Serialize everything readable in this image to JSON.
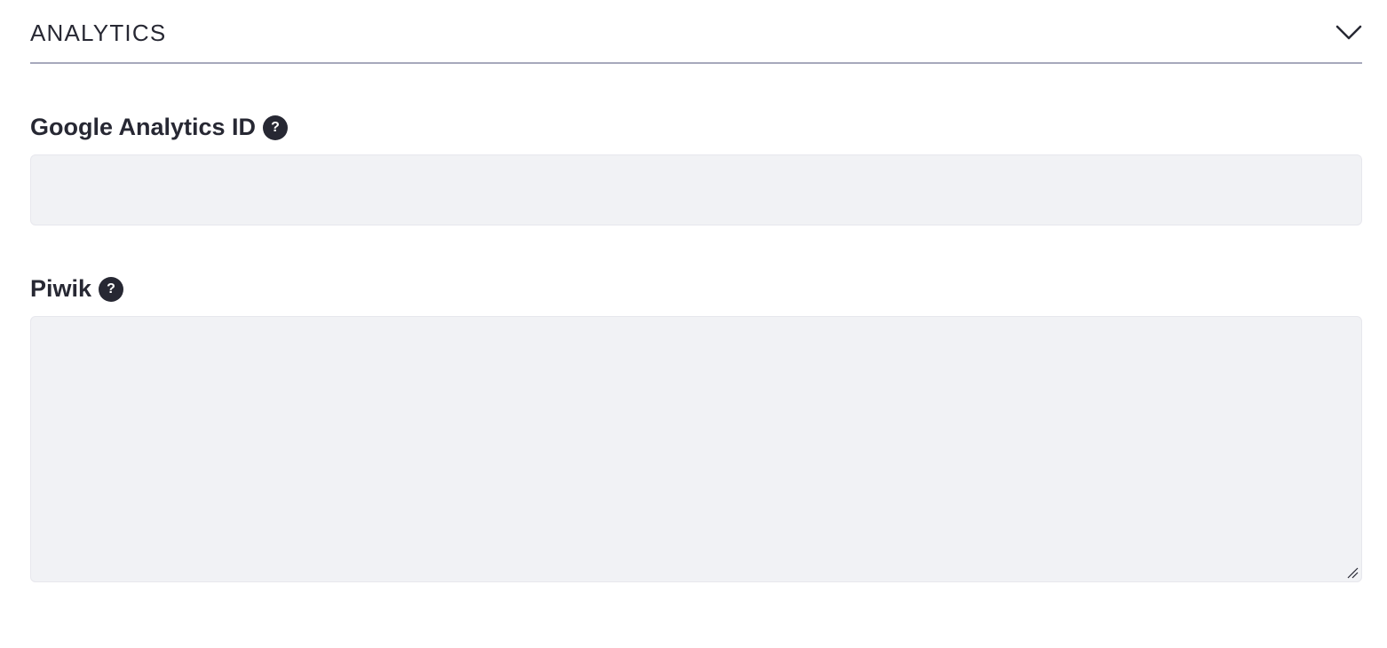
{
  "panel": {
    "title": "ANALYTICS",
    "toggle_icon": "chevron-down-icon",
    "expanded": true
  },
  "fields": {
    "google_analytics": {
      "label": "Google Analytics ID",
      "help_icon": "question-circle-icon",
      "help_glyph": "?",
      "value": "",
      "placeholder": ""
    },
    "piwik": {
      "label": "Piwik",
      "help_icon": "question-circle-icon",
      "help_glyph": "?",
      "value": "",
      "placeholder": ""
    }
  },
  "colors": {
    "text": "#272833",
    "input_bg": "#f1f2f5",
    "input_border": "#e7e7ed",
    "divider": "#a7a9bc"
  }
}
